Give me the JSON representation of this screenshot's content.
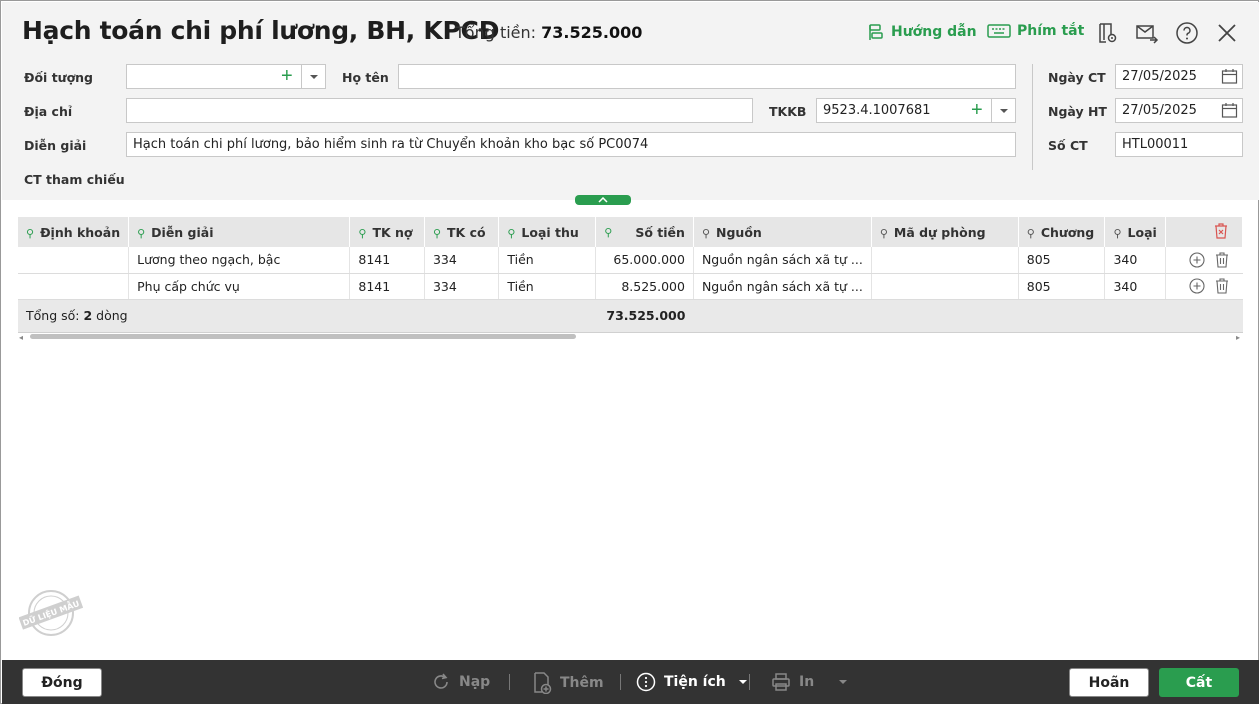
{
  "header": {
    "title": "Hạch toán chi phí lương, BH, KPCĐ",
    "total_label": "Tổng tiền:",
    "total_value": "73.525.000",
    "guide": "Hướng dẫn",
    "shortcuts": "Phím tắt",
    "accent": "#2a9d4f"
  },
  "form": {
    "doi_tuong_label": "Đối tượng",
    "doi_tuong_value": "",
    "ho_ten_label": "Họ tên",
    "ho_ten_value": "",
    "dia_chi_label": "Địa chỉ",
    "dia_chi_value": "",
    "tkkb_label": "TKKB",
    "tkkb_value": "9523.4.1007681",
    "dien_giai_label": "Diễn giải",
    "dien_giai_value": "Hạch toán chi phí lương, bảo hiểm sinh ra từ Chuyển khoản kho bạc số PC0074",
    "ct_tham_chieu_label": "CT tham chiếu",
    "ngay_ct_label": "Ngày CT",
    "ngay_ct_value": "27/05/2025",
    "ngay_ht_label": "Ngày HT",
    "ngay_ht_value": "27/05/2025",
    "so_ct_label": "Số CT",
    "so_ct_value": "HTL00011"
  },
  "grid": {
    "columns": [
      "Định khoản",
      "Diễn giải",
      "TK nợ",
      "TK có",
      "Loại thu",
      "Số tiền",
      "Nguồn",
      "Mã dự phòng",
      "Chương",
      "Loại"
    ],
    "rows": [
      {
        "dinh_khoan": "",
        "dien_giai": "Lương theo ngạch, bậc",
        "tk_no": "8141",
        "tk_co": "334",
        "loai_thu": "Tiền",
        "so_tien": "65.000.000",
        "nguon": "Nguồn ngân sách xã tự ...",
        "ma_du_phong": "",
        "chuong": "805",
        "loai": "340"
      },
      {
        "dinh_khoan": "",
        "dien_giai": "Phụ cấp chức vụ",
        "tk_no": "8141",
        "tk_co": "334",
        "loai_thu": "Tiền",
        "so_tien": "8.525.000",
        "nguon": "Nguồn ngân sách xã tự ...",
        "ma_du_phong": "",
        "chuong": "805",
        "loai": "340"
      }
    ],
    "summary_prefix": "Tổng số: ",
    "summary_count": "2",
    "summary_suffix": " dòng",
    "summary_total": "73.525.000"
  },
  "stamp": "DỮ LIỆU MẪU",
  "footer": {
    "close": "Đóng",
    "reload": "Nạp",
    "add": "Thêm",
    "utilities": "Tiện ích",
    "print": "In",
    "undo": "Hoãn",
    "save": "Cất"
  }
}
